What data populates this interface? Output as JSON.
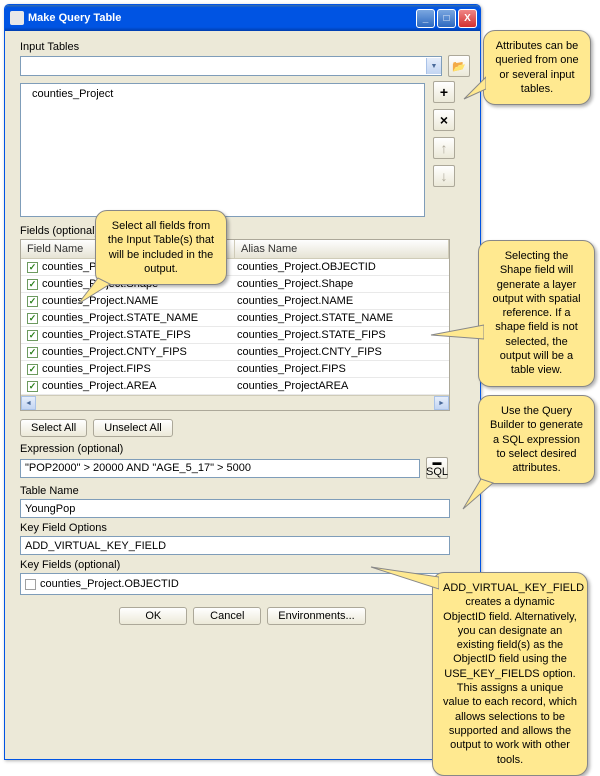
{
  "window": {
    "title": "Make Query Table"
  },
  "title_buttons": {
    "min": "_",
    "max": "□",
    "close": "X"
  },
  "input_tables": {
    "label": "Input Tables",
    "items": [
      "counties_Project"
    ]
  },
  "side_buttons": {
    "add": "+",
    "remove": "×",
    "up": "↑",
    "down": "↓"
  },
  "fields": {
    "label": "Fields (optional)",
    "header_col1": "Field Name",
    "header_col2": "Alias Name",
    "rows": [
      {
        "field": "counties_Project.OBJECTID",
        "alias": "counties_Project.OBJECTID"
      },
      {
        "field": "counties_Project.Shape",
        "alias": "counties_Project.Shape"
      },
      {
        "field": "counties_Project.NAME",
        "alias": "counties_Project.NAME"
      },
      {
        "field": "counties_Project.STATE_NAME",
        "alias": "counties_Project.STATE_NAME"
      },
      {
        "field": "counties_Project.STATE_FIPS",
        "alias": "counties_Project.STATE_FIPS"
      },
      {
        "field": "counties_Project.CNTY_FIPS",
        "alias": "counties_Project.CNTY_FIPS"
      },
      {
        "field": "counties_Project.FIPS",
        "alias": "counties_Project.FIPS"
      },
      {
        "field": "counties_Project.AREA",
        "alias": "counties_ProjectAREA"
      }
    ]
  },
  "buttons": {
    "select_all": "Select All",
    "unselect_all": "Unselect All",
    "ok": "OK",
    "cancel": "Cancel",
    "environments": "Environments...",
    "sql": "SQL"
  },
  "expression": {
    "label": "Expression (optional)",
    "value": "\"POP2000\" > 20000 AND \"AGE_5_17\" > 5000"
  },
  "table_name": {
    "label": "Table Name",
    "value": "YoungPop"
  },
  "key_options": {
    "label": "Key Field Options",
    "value": "ADD_VIRTUAL_KEY_FIELD"
  },
  "key_fields": {
    "label": "Key Fields (optional)",
    "item": "counties_Project.OBJECTID"
  },
  "callouts": {
    "c1": "Attributes can be queried from one or several input tables.",
    "c2": "Select all fields from the Input Table(s) that will be included in the output.",
    "c3": "Selecting the Shape field will generate a layer output with spatial reference. If a shape field is not selected, the output will be a table view.",
    "c4": "Use the Query Builder to generate a SQL expression to select desired attributes.",
    "c5": "ADD_VIRTUAL_KEY_FIELD creates a dynamic ObjectID field.  Alternatively, you can designate an existing field(s) as the ObjectID field using the USE_KEY_FIELDS option. This assigns a unique value to each record, which allows selections to be supported and allows the output to work with other tools."
  }
}
